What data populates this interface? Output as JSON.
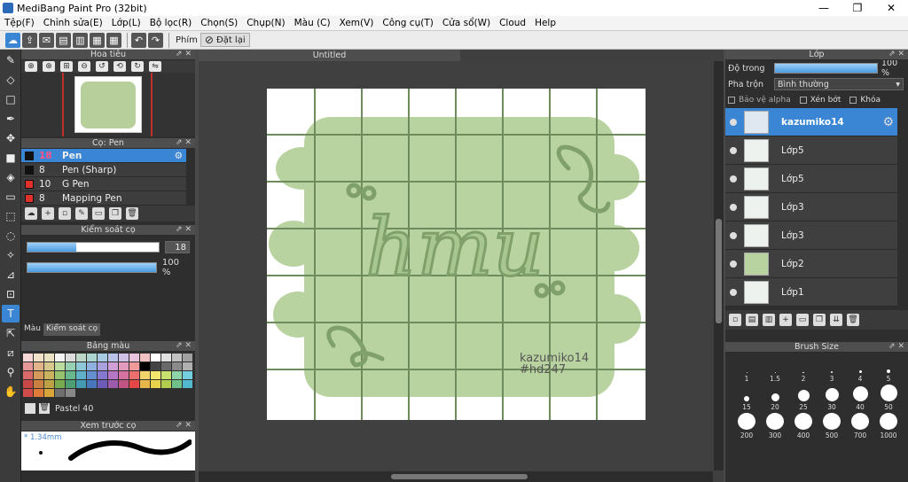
{
  "window": {
    "title": "MediBang Paint Pro (32bit)",
    "minimize": "—",
    "maximize": "❐",
    "close": "✕"
  },
  "menu": [
    "Tệp(F)",
    "Chỉnh sửa(E)",
    "Lớp(L)",
    "Bộ lọc(R)",
    "Chọn(S)",
    "Chụp(N)",
    "Màu (C)",
    "Xem(V)",
    "Công cụ(T)",
    "Cửa sổ(W)",
    "Cloud",
    "Help"
  ],
  "toolbar": {
    "keys_label": "Phím",
    "reset_label": "Đặt lại",
    "reset_icon": "⊘"
  },
  "panels": {
    "navigator": "Hoa tiêu",
    "brush": "Cọ: Pen",
    "brush_control": "Kiểm soát cọ",
    "color_tab": "Màu",
    "brush_control_tab": "Kiểm soát cọ",
    "palette": "Bảng màu",
    "palette_name": "Pastel 40",
    "preview": "Xem trước cọ",
    "preview_size": "* 1.34mm",
    "layer": "Lớp",
    "brush_size": "Brush Size"
  },
  "brushes": [
    {
      "size": "18",
      "name": "Pen",
      "color": "#111111",
      "selected": true
    },
    {
      "size": "8",
      "name": "Pen (Sharp)",
      "color": "#111111",
      "selected": false
    },
    {
      "size": "10",
      "name": "G Pen",
      "color": "#e0302a",
      "selected": false
    },
    {
      "size": "8",
      "name": "Mapping Pen",
      "color": "#e0302a",
      "selected": false
    }
  ],
  "brush_control": {
    "size": "18",
    "size_fraction": 0.37,
    "opacity": "100 %",
    "opacity_fraction": 1.0
  },
  "palette_colors": [
    "#f5d7d7",
    "#f2e1c9",
    "#e9e3c4",
    "#f4f4f4",
    "#dcdcdc",
    "#bcd7c5",
    "#aed4cf",
    "#a8c9e4",
    "#b9c3e8",
    "#cfc2e6",
    "#e8c4dc",
    "#f2c2c2",
    "#ffffff",
    "#e0e0e0",
    "#c0c0c0",
    "#a0a0a0",
    "#e69898",
    "#e2b48c",
    "#d7c98e",
    "#bcdca0",
    "#98d0b2",
    "#8ec8d8",
    "#8fb1df",
    "#a9a0de",
    "#cf9fd6",
    "#e39cbd",
    "#f09a9a",
    "#000000",
    "#444444",
    "#6a6a6a",
    "#8a8a8a",
    "#b0b0b0",
    "#d96a6a",
    "#d6995c",
    "#cab25e",
    "#97c36e",
    "#67b88e",
    "#5fb1c8",
    "#6391d0",
    "#8677cf",
    "#b877c6",
    "#d6729f",
    "#ec6f6f",
    "#f3d36b",
    "#f4e56f",
    "#c8e06e",
    "#8fd4a8",
    "#73cfe0",
    "#c84848",
    "#c98040",
    "#bca145",
    "#7aaa4f",
    "#4d9f73",
    "#4499b3",
    "#4776bb",
    "#6d5cb8",
    "#9d5bab",
    "#c05483",
    "#e64848",
    "#e8b74a",
    "#e7d24c",
    "#b1cc4e",
    "#70c089",
    "#52b9cf",
    "#d24b4b",
    "#e07b3a",
    "#d9a43a",
    "#6f6f6f",
    "#888888"
  ],
  "document": {
    "tab": "Untitled"
  },
  "artwork": {
    "text": "hmu",
    "signature_line1": "kazumiko14",
    "signature_line2": "#hd247"
  },
  "layer_props": {
    "opacity_label": "Độ trong",
    "opacity_value": "100 %",
    "opacity_fraction": 1.0,
    "blend_label": "Pha trộn",
    "blend_value": "Bình thường",
    "alpha_protect": "Bảo vệ alpha",
    "clip": "Xén bớt",
    "lock": "Khóa"
  },
  "layers": [
    {
      "name": "kazumiko14",
      "selected": true
    },
    {
      "name": "Lớp5",
      "selected": false
    },
    {
      "name": "Lớp5",
      "selected": false
    },
    {
      "name": "Lớp3",
      "selected": false
    },
    {
      "name": "Lớp3",
      "selected": false
    },
    {
      "name": "Lớp2",
      "selected": false
    },
    {
      "name": "Lớp1",
      "selected": false
    }
  ],
  "brush_sizes": [
    "1",
    "1.5",
    "2",
    "3",
    "4",
    "5",
    "15",
    "20",
    "25",
    "30",
    "40",
    "50",
    "200",
    "300",
    "400",
    "500",
    "700",
    "1000"
  ]
}
